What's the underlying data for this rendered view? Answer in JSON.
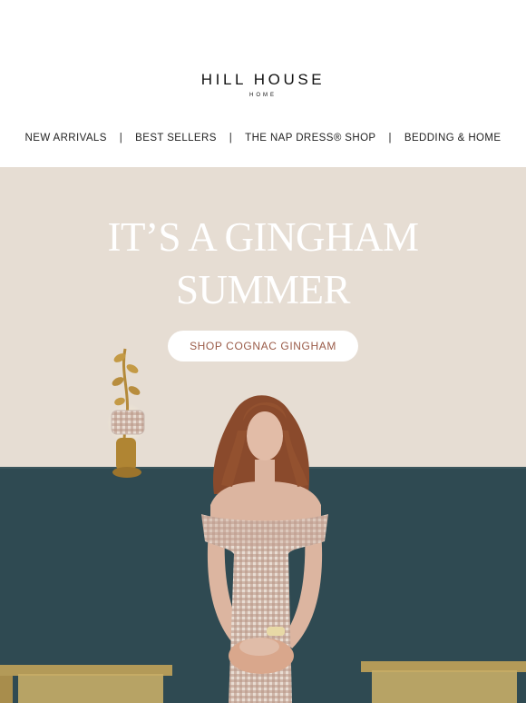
{
  "brand": {
    "name": "HILL HOUSE",
    "sub": "HOME"
  },
  "nav": {
    "items": [
      "NEW ARRIVALS",
      "BEST SELLERS",
      "THE NAP DRESS® SHOP",
      "BEDDING & HOME"
    ],
    "separator": "|"
  },
  "hero": {
    "headline_line1": "IT’S A GINGHAM",
    "headline_line2": "SUMMER",
    "cta_label": "SHOP COGNAC GINGHAM",
    "colors": {
      "wall_upper": "#e6ddd3",
      "wall_lower": "#2f4a52",
      "cta_text": "#9a5b48"
    }
  }
}
